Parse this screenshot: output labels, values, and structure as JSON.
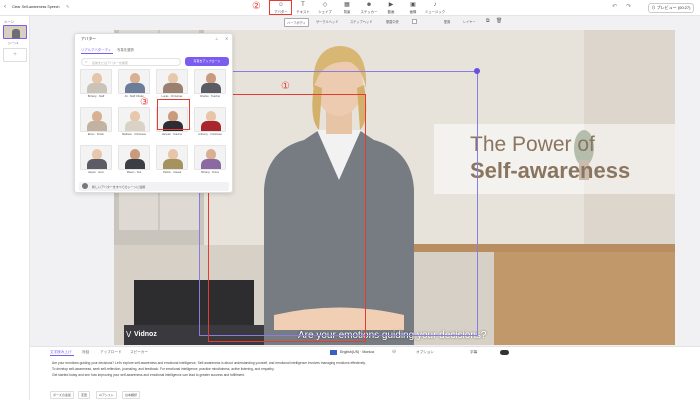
{
  "header": {
    "title": "Clear Self-awareness Speech",
    "preview_label": "プレビュー (00:27)",
    "tools": [
      {
        "label": "アバター",
        "icon": "avatar-icon"
      },
      {
        "label": "テキスト",
        "icon": "text-icon"
      },
      {
        "label": "シェイプ",
        "icon": "shape-icon"
      },
      {
        "label": "背景",
        "icon": "background-icon"
      },
      {
        "label": "ステッカー",
        "icon": "sticker-icon"
      },
      {
        "label": "動画",
        "icon": "video-icon"
      },
      {
        "label": "画像",
        "icon": "image-icon"
      },
      {
        "label": "ミュージック",
        "icon": "music-icon"
      }
    ]
  },
  "left_rail": {
    "scenes_label": "シーン",
    "scene1_label": "シーン1"
  },
  "avatar_panel": {
    "title": "アバター",
    "tabs": [
      "リアルアバターティ",
      "2Dアバター",
      "カスタム作成"
    ],
    "tab_short": [
      "リアルアバターディ",
      "写真を選択"
    ],
    "search_placeholder": "名前またはアバターを検索",
    "upload_button": "写真をアップロード",
    "apply_text": "新しいアバターをすべてのシーンに適用",
    "avatars": [
      [
        "Brittany · Staff",
        "Ali · Staff Ofudai",
        "Lucas · Christmas",
        "Charles · Teacher"
      ],
      [
        "Elmer · Kristin",
        "Madison · Christmas",
        "Hannah · Teacher",
        "Anthony · Christmas"
      ],
      [
        "Harper · Hoor",
        "Mason · Suit",
        "Patrick · Casual",
        "Brittany · Dress"
      ]
    ]
  },
  "canvas_toolbar": [
    "ハーフボディ",
    "サークルヘッド",
    "ステップヘッド",
    "垂直中央",
    "配置",
    "レイヤー"
  ],
  "video": {
    "headline_1": "The Power of",
    "headline_2": "Self-awareness",
    "subtitle": "Are your emotions guiding your decisions?",
    "watermark": "Vidnoz"
  },
  "annotations": {
    "one": "①",
    "two": "②",
    "three": "③"
  },
  "bottom": {
    "tabs": [
      "文字読み上げ",
      "対話",
      "アップロード",
      "スピーカー"
    ],
    "voice": "English(US) · Monica",
    "options": "オプション",
    "subtitle_toggle": "字幕",
    "script_lines": [
      "Are your emotions guiding your decisions? Let's explore self-awareness and emotional intelligence. Self-awareness is about understanding yourself, and emotional intelligence involves managing emotions effectively.",
      "To develop self-awareness, seek self-reflection, journaling, and feedback. For emotional intelligence, practice mindfulness, active listening, and empathy.",
      "Get started today and see how improving your self-awareness and emotional intelligence can lead to greater success and fulfillment."
    ],
    "actions": [
      "ポーズの追加",
      "変更",
      "AIアシスト",
      "台本翻訳"
    ]
  }
}
